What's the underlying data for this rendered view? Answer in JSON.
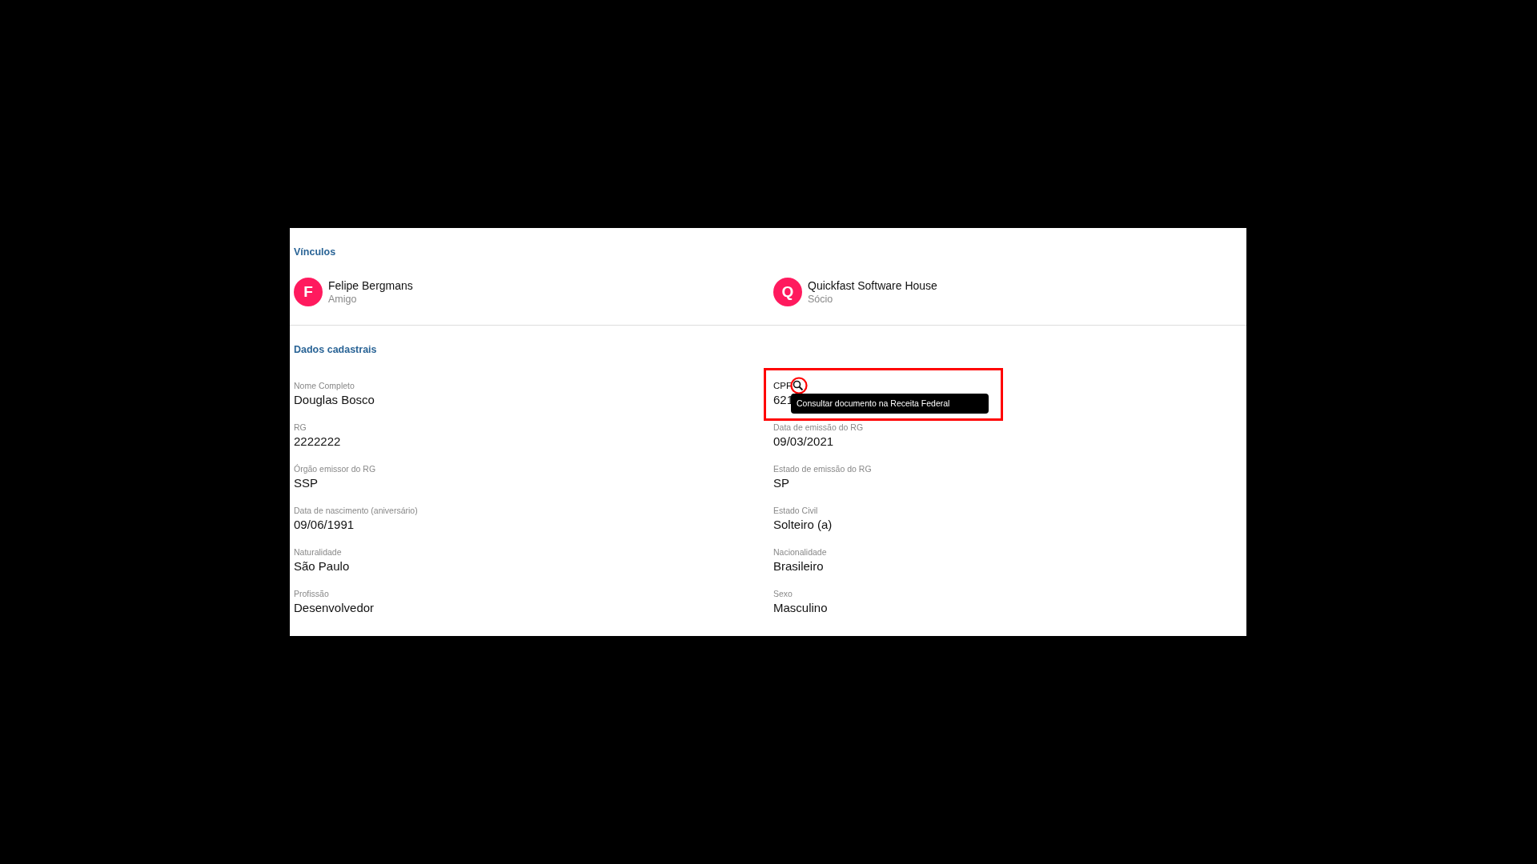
{
  "sections": [
    {
      "kind": "links",
      "title": "Vínculos",
      "links": [
        {
          "initial": "F",
          "name": "Felipe Bergmans",
          "relation": "Amigo"
        },
        {
          "initial": "Q",
          "name": "Quickfast Software House",
          "relation": "Sócio"
        }
      ]
    },
    {
      "kind": "fields",
      "title": "Dados cadastrais",
      "fields": [
        {
          "label": "Nome Completo",
          "value": "Douglas Bosco"
        },
        {
          "label": "CPF",
          "value": "621",
          "search": true,
          "highlighted": true,
          "tooltip": "Consultar documento na Receita Federal"
        },
        {
          "label": "RG",
          "value": "2222222"
        },
        {
          "label": "Data de emissão do RG",
          "value": "09/03/2021"
        },
        {
          "label": "Órgão emissor do RG",
          "value": "SSP"
        },
        {
          "label": "Estado de emissão do RG",
          "value": "SP"
        },
        {
          "label": "Data de nascimento (aniversário)",
          "value": "09/06/1991"
        },
        {
          "label": "Estado Civil",
          "value": "Solteiro (a)"
        },
        {
          "label": "Naturalidade",
          "value": "São Paulo"
        },
        {
          "label": "Nacionalidade",
          "value": "Brasileiro"
        },
        {
          "label": "Profissão",
          "value": "Desenvolvedor"
        },
        {
          "label": "Sexo",
          "value": "Masculino"
        }
      ]
    }
  ]
}
